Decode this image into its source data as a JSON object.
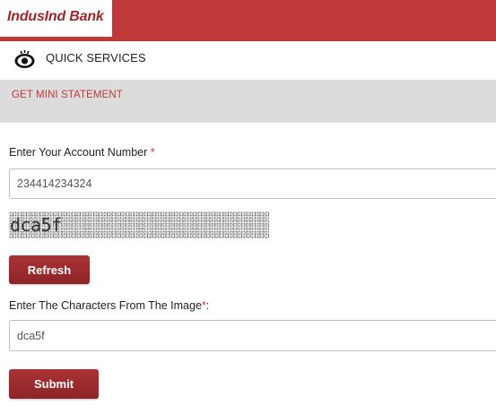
{
  "bank": {
    "name": "IndusInd Bank"
  },
  "quick_services": {
    "label": "QUICK SERVICES",
    "icon": "eye-icon"
  },
  "section": {
    "title": "GET MINI STATEMENT"
  },
  "account": {
    "label": "Enter Your Account Number ",
    "required_mark": "*",
    "value": "234414234324"
  },
  "captcha": {
    "text": "dca5f"
  },
  "refresh": {
    "label": "Refresh"
  },
  "characters": {
    "label": "Enter The Characters From The Image",
    "required_mark": "*",
    "suffix": ":",
    "value": "dca5f"
  },
  "submit": {
    "label": "Submit"
  },
  "colors": {
    "brand": "#c0393b",
    "button": "#9a2b2e",
    "band": "#dcdcdc"
  }
}
